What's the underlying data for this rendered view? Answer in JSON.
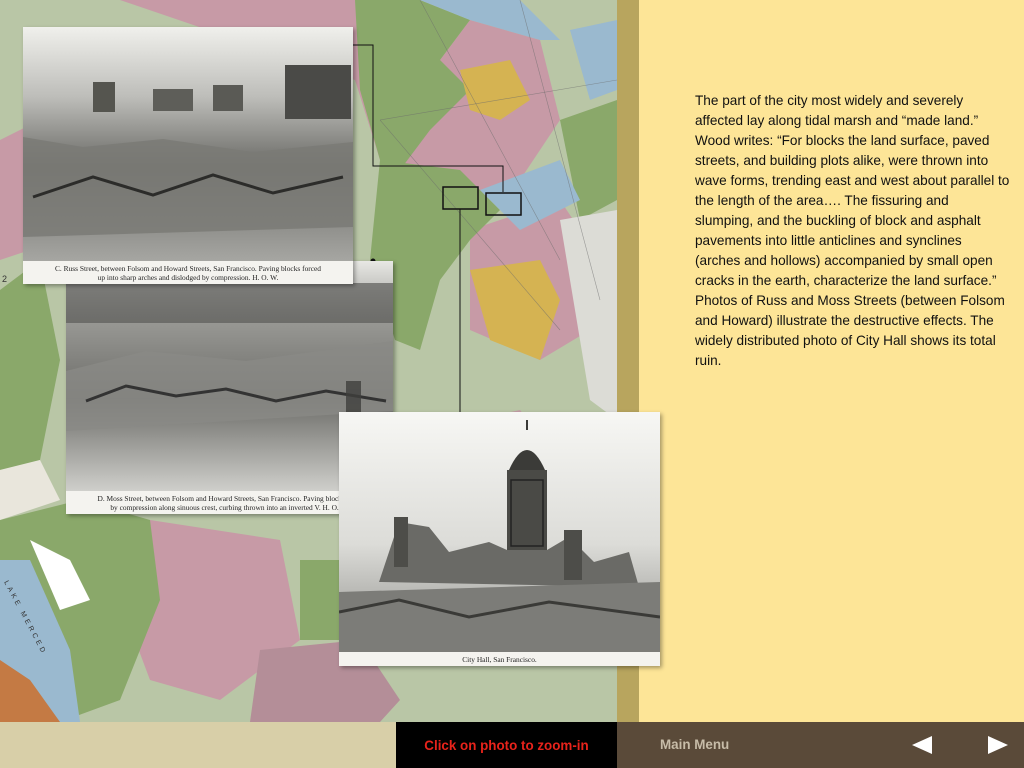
{
  "body_text": "The part of the city most widely and severely affected lay along tidal marsh and “made land.” Wood writes: “For blocks the land surface, paved streets, and building plots alike, were thrown into wave forms, trending east and west about parallel to the length of the area…. The fissuring and slumping, and the buckling of block and asphalt pavements into little anticlines and synclines (arches and hollows) accompanied by small open cracks in the earth, characterize the land surface.” Photos of Russ and Moss Streets (between Folsom and Howard) illustrate the destructive effects. The widely distributed photo of City Hall shows its total ruin.",
  "photos": {
    "russ": {
      "caption": "C.  Russ Street, between Folsom and Howard Streets, San Francisco.   Paving blocks forced\nup into sharp arches and dislodged by compression.   H. O. W."
    },
    "moss": {
      "caption": "D.  Moss Street, between Folsom and Howard Streets, San Francisco.   Paving blocks archt\nby compression along sinuous crest, curbing thrown into an inverted V.   H. O. W."
    },
    "city_hall": {
      "caption": "City Hall, San Francisco."
    }
  },
  "map_labels": {
    "lake_merced": "LAKE MERCED",
    "edge_numeral": "2"
  },
  "bottom_bar": {
    "zoom_hint": "Click on photo to zoom-in",
    "main_menu": "Main Menu"
  },
  "icons": {
    "prev": "triangle-left",
    "next": "triangle-right"
  },
  "colors": {
    "panel_bg": "#fde597",
    "divider": "#b8a55e",
    "nav_bg": "#5a4a39",
    "zoom_hint_text": "#e8231b",
    "map_green": "#8aa86a",
    "map_pink": "#c79aa6",
    "map_blue": "#9ab9cf",
    "map_yellow": "#d5b352"
  }
}
